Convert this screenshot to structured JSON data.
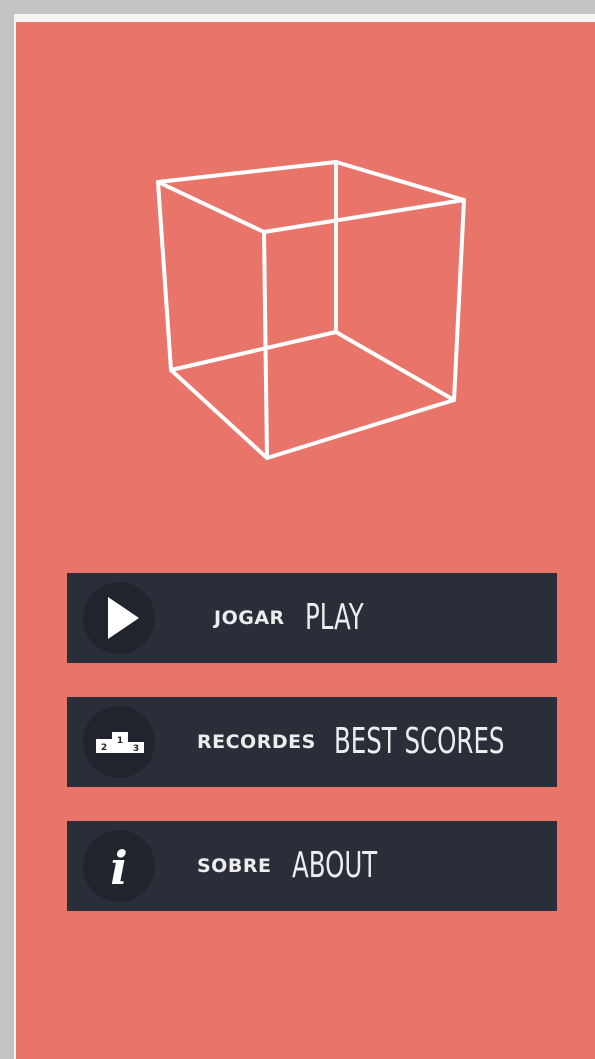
{
  "menu": {
    "play": {
      "pt_label": "JOGAR",
      "en_label": "PLAY",
      "icon": "play-icon"
    },
    "scores": {
      "pt_label": "RECORDES",
      "en_label": "BEST SCORES",
      "icon": "podium-icon",
      "podium_places": [
        "2",
        "1",
        "3"
      ]
    },
    "about": {
      "pt_label": "SOBRE",
      "en_label": "ABOUT",
      "icon": "info-icon",
      "glyph": "i"
    }
  },
  "colors": {
    "background": "#e9756a",
    "button": "#292e38",
    "icon_circle": "#20252d",
    "text": "#ededed",
    "cube_stroke": "#ffffff"
  }
}
